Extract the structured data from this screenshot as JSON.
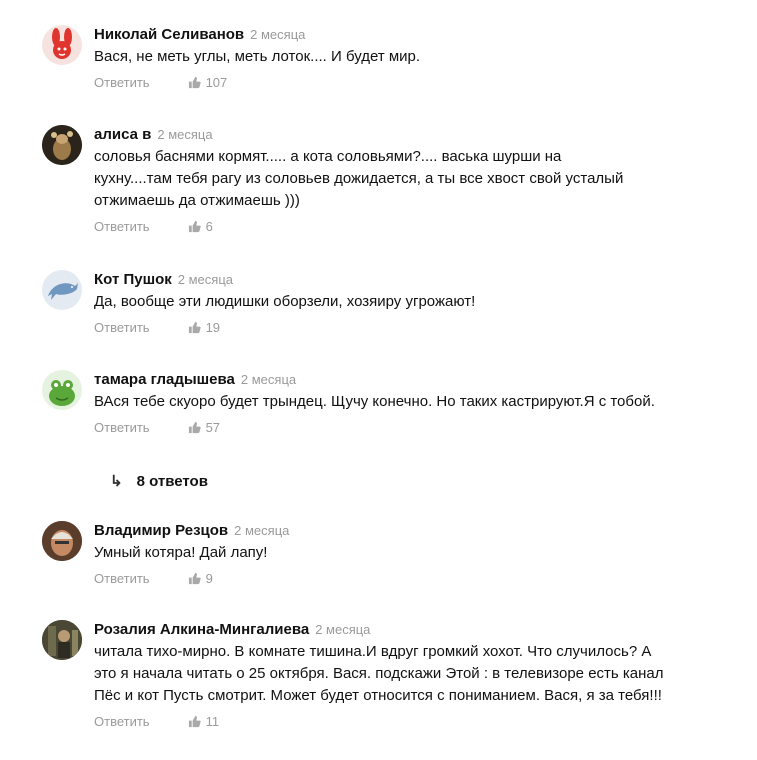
{
  "comments": [
    {
      "author": "Николай Селиванов",
      "date": "2 месяца",
      "text": "Вася, не меть углы, меть лоток.... И будет мир.",
      "reply_label": "Ответить",
      "likes": "107",
      "avatar": "bunny-avatar"
    },
    {
      "author": "алиса в",
      "date": "2 месяца",
      "text": "соловья баснями кормят..... а кота соловьями?.... васька шурши на кухну....там тебя рагу из соловьев дожидается, а ты все хвост свой усталый отжимаешь да отжимаешь )))",
      "reply_label": "Ответить",
      "likes": "6",
      "avatar": "photo-avatar"
    },
    {
      "author": "Кот Пушок",
      "date": "2 месяца",
      "text": "Да, вообще эти людишки оборзели, хозяиру угрожают!",
      "reply_label": "Ответить",
      "likes": "19",
      "avatar": "dolphin-avatar"
    },
    {
      "author": "тамара гладышева",
      "date": "2 месяца",
      "text": "ВАся тебе скуоро будет трындец. Щучу конечно. Но таких кастрируют.Я с тобой.",
      "reply_label": "Ответить",
      "likes": "57",
      "avatar": "frog-avatar"
    },
    {
      "author": "Владимир Резцов",
      "date": "2 месяца",
      "text": "Умный котяра! Дай лапу!",
      "reply_label": "Ответить",
      "likes": "9",
      "avatar": "photo-avatar"
    },
    {
      "author": "Розалия Алкина-Мингалиева",
      "date": "2 месяца",
      "text": "читала тихо-мирно. В комнате тишина.И вдруг громкий хохот. Что случилось? А это я начала читать о 25 октября. Вася. подскажи Этой : в телевизоре есть канал Пёс и кот Пусть смотрит. Может будет относится с пониманием. Вася, я за тебя!!!",
      "reply_label": "Ответить",
      "likes": "11",
      "avatar": "photo-avatar"
    }
  ],
  "replies_toggle": {
    "arrow": "↳",
    "label": "8 ответов"
  }
}
